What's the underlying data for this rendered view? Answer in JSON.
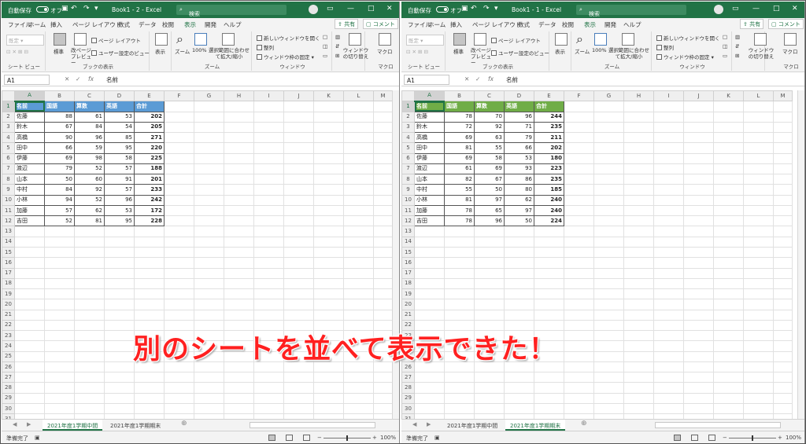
{
  "windows": [
    {
      "id": "w1",
      "autosave_label": "自動保存",
      "autosave_state": "オフ",
      "doc_title": "Book1 - 2 - Excel",
      "search_placeholder": "検索",
      "tabs": [
        "ファイル",
        "ホーム",
        "挿入",
        "ページ レイアウト",
        "数式",
        "データ",
        "校閲",
        "表示",
        "開発",
        "ヘルプ"
      ],
      "active_tab": "表示",
      "share_label": "共有",
      "comment_label": "コメント",
      "ribbon": {
        "sheetview_group": "シート ビュー",
        "sheetview_dropdown": "既定",
        "workbookview_group": "ブックの表示",
        "normal": "標準",
        "pagebreak": "改ページ プレビュー",
        "pagelayout": "ページ レイアウト",
        "userview": "ユーザー設定のビュー",
        "show": "表示",
        "zoom_group": "ズーム",
        "zoom": "ズーム",
        "zoom100": "100%",
        "zoomsel": "選択範囲に合わせて拡大/縮小",
        "window_group": "ウィンドウ",
        "newwin": "新しいウィンドウを開く",
        "arrange": "整列",
        "freeze": "ウィンドウ枠の固定",
        "switchwin": "ウィンドウの切り替え",
        "macro_group": "マクロ",
        "macro": "マクロ"
      },
      "namebox": "A1",
      "formula": "名前",
      "columns": [
        "A",
        "B",
        "C",
        "D",
        "E",
        "F",
        "G",
        "H",
        "I",
        "J",
        "K",
        "L",
        "M"
      ],
      "headers": [
        "名前",
        "国語",
        "算数",
        "英語",
        "合計"
      ],
      "header_color": "#5b9bd5",
      "rows": [
        [
          "佐藤",
          "88",
          "61",
          "53",
          "202"
        ],
        [
          "鈴木",
          "67",
          "84",
          "54",
          "205"
        ],
        [
          "高橋",
          "90",
          "96",
          "85",
          "271"
        ],
        [
          "田中",
          "66",
          "59",
          "95",
          "220"
        ],
        [
          "伊藤",
          "69",
          "98",
          "58",
          "225"
        ],
        [
          "渡辺",
          "79",
          "52",
          "57",
          "188"
        ],
        [
          "山本",
          "50",
          "60",
          "91",
          "201"
        ],
        [
          "中村",
          "84",
          "92",
          "57",
          "233"
        ],
        [
          "小林",
          "94",
          "52",
          "96",
          "242"
        ],
        [
          "加藤",
          "57",
          "62",
          "53",
          "172"
        ],
        [
          "吉田",
          "52",
          "81",
          "95",
          "228"
        ]
      ],
      "row_numbers": [
        "1",
        "2",
        "3",
        "4",
        "5",
        "6",
        "7",
        "8",
        "9",
        "10",
        "11",
        "12",
        "13",
        "14",
        "15",
        "16",
        "17",
        "18",
        "19",
        "20",
        "21",
        "22",
        "23",
        "24",
        "25",
        "26",
        "27",
        "28",
        "29",
        "30",
        "31"
      ],
      "sheet_tabs": [
        "2021年度1学期中間",
        "2021年度1学期期末"
      ],
      "active_sheet": 0,
      "status_ready": "準備完了",
      "zoom_level": "100%"
    },
    {
      "id": "w2",
      "autosave_label": "自動保存",
      "autosave_state": "オフ",
      "doc_title": "Book1 - 1 - Excel",
      "search_placeholder": "検索",
      "tabs": [
        "ファイル",
        "ホーム",
        "挿入",
        "ページ レイアウト",
        "数式",
        "データ",
        "校閲",
        "表示",
        "開発",
        "ヘルプ"
      ],
      "active_tab": "表示",
      "share_label": "共有",
      "comment_label": "コメント",
      "ribbon": {
        "sheetview_group": "シート ビュー",
        "sheetview_dropdown": "既定",
        "workbookview_group": "ブックの表示",
        "normal": "標準",
        "pagebreak": "改ページ プレビュー",
        "pagelayout": "ページ レイアウト",
        "userview": "ユーザー設定のビュー",
        "show": "表示",
        "zoom_group": "ズーム",
        "zoom": "ズーム",
        "zoom100": "100%",
        "zoomsel": "選択範囲に合わせて拡大/縮小",
        "window_group": "ウィンドウ",
        "newwin": "新しいウィンドウを開く",
        "arrange": "整列",
        "freeze": "ウィンドウ枠の固定",
        "switchwin": "ウィンドウの切り替え",
        "macro_group": "マクロ",
        "macro": "マクロ"
      },
      "namebox": "A1",
      "formula": "名前",
      "columns": [
        "A",
        "B",
        "C",
        "D",
        "E",
        "F",
        "G",
        "H",
        "I",
        "J",
        "K",
        "L",
        "M"
      ],
      "headers": [
        "名前",
        "国語",
        "算数",
        "英語",
        "合計"
      ],
      "header_color": "#70ad47",
      "rows": [
        [
          "佐藤",
          "78",
          "70",
          "96",
          "244"
        ],
        [
          "鈴木",
          "72",
          "92",
          "71",
          "235"
        ],
        [
          "高橋",
          "69",
          "63",
          "79",
          "211"
        ],
        [
          "田中",
          "81",
          "55",
          "66",
          "202"
        ],
        [
          "伊藤",
          "69",
          "58",
          "53",
          "180"
        ],
        [
          "渡辺",
          "61",
          "69",
          "93",
          "223"
        ],
        [
          "山本",
          "82",
          "67",
          "86",
          "235"
        ],
        [
          "中村",
          "55",
          "50",
          "80",
          "185"
        ],
        [
          "小林",
          "81",
          "97",
          "62",
          "240"
        ],
        [
          "加藤",
          "78",
          "65",
          "97",
          "240"
        ],
        [
          "吉田",
          "78",
          "96",
          "50",
          "224"
        ]
      ],
      "row_numbers": [
        "1",
        "2",
        "3",
        "4",
        "5",
        "6",
        "7",
        "8",
        "9",
        "10",
        "11",
        "12",
        "13",
        "14",
        "15",
        "16",
        "17",
        "18",
        "19",
        "20",
        "21",
        "22",
        "23",
        "24",
        "25",
        "26",
        "27",
        "28",
        "29",
        "30",
        "31"
      ],
      "sheet_tabs": [
        "2021年度1学期中間",
        "2021年度1学期期末"
      ],
      "active_sheet": 1,
      "status_ready": "準備完了",
      "zoom_level": "100%"
    }
  ],
  "overlay_caption": "別のシートを並べて表示できた！"
}
